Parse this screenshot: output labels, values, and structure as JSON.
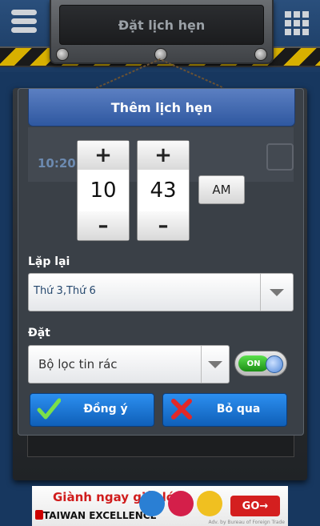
{
  "header": {
    "title": "Đặt lịch hẹn"
  },
  "dialog": {
    "title": "Thêm lịch hẹn",
    "background_time": "10:20",
    "time": {
      "hour": "10",
      "minute": "43",
      "ampm": "AM",
      "plus": "+",
      "minus": "–"
    },
    "repeat_label": "Lặp lại",
    "repeat_value": "Thứ 3,Thứ 6",
    "set_label": "Đặt",
    "set_value": "Bộ lọc tin rác",
    "toggle_text": "ON",
    "toggle_on": true,
    "ok_label": "Đồng ý",
    "cancel_label": "Bỏ qua"
  },
  "ad": {
    "line1": "Giành ngay giải lớn",
    "line2": "TAIWAN EXCELLENCE",
    "go": "GO",
    "go_arrow": "→",
    "footer": "Adv. by Bureau of Foreign Trade"
  },
  "colors": {
    "accent_blue": "#2c8ff0",
    "title_blue": "#2f58a0",
    "toggle_green": "#1c8f16",
    "cancel_red": "#d41f1f"
  }
}
